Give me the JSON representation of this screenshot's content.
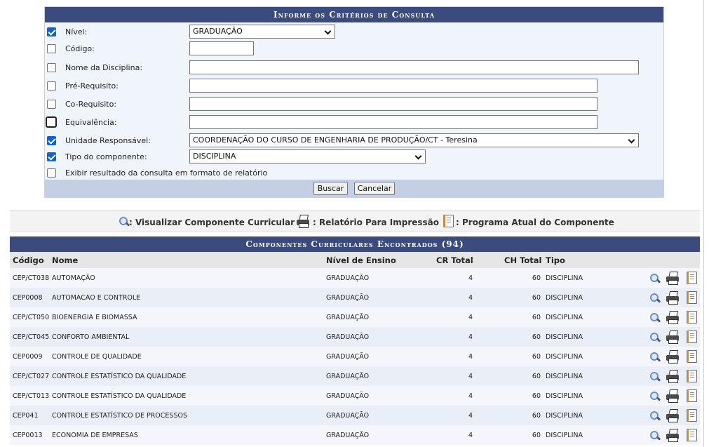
{
  "form": {
    "title": "Informe os Critérios de Consulta",
    "fields": [
      {
        "label": "Nível:",
        "checked": true,
        "control": "select",
        "value": "GRADUAÇÃO"
      },
      {
        "label": "Código:",
        "checked": false,
        "control": "input",
        "value": ""
      },
      {
        "label": "Nome da Disciplina:",
        "checked": false,
        "control": "input",
        "value": ""
      },
      {
        "label": "Pré-Requisito:",
        "checked": false,
        "control": "input",
        "value": ""
      },
      {
        "label": "Co-Requisito:",
        "checked": false,
        "control": "input",
        "value": ""
      },
      {
        "label": "Equivalência:",
        "checked": false,
        "control": "input",
        "value": ""
      },
      {
        "label": "Unidade Responsável:",
        "checked": true,
        "control": "select",
        "value": "COORDENAÇÃO DO CURSO DE ENGENHARIA DE PRODUÇÃO/CT - Teresina"
      },
      {
        "label": "Tipo do componente:",
        "checked": true,
        "control": "select",
        "value": "DISCIPLINA"
      },
      {
        "label": "Exibir resultado da consulta em formato de relatório",
        "checked": false,
        "control": "none",
        "value": ""
      }
    ],
    "search_button": "Buscar",
    "cancel_button": "Cancelar"
  },
  "legend": {
    "view": ": Visualizar Componente Curricular",
    "print": ": Relatório Para Impressão",
    "program": ": Programa Atual do Componente"
  },
  "results": {
    "title": "Componentes Curriculares Encontrados (94)",
    "headers": {
      "code": "Código",
      "name": "Nome",
      "level": "Nível de Ensino",
      "cr": "CR Total",
      "ch": "CH Total",
      "type": "Tipo"
    },
    "rows": [
      {
        "code": "CEP/CT038",
        "name": "AUTOMAÇÃO",
        "level": "GRADUAÇÃO",
        "cr": "4",
        "ch": "60",
        "type": "DISCIPLINA"
      },
      {
        "code": "CEP0008",
        "name": "AUTOMACAO E CONTROLE",
        "level": "GRADUAÇÃO",
        "cr": "4",
        "ch": "60",
        "type": "DISCIPLINA"
      },
      {
        "code": "CEP/CT050",
        "name": "BIOENERGIA E BIOMASSA",
        "level": "GRADUAÇÃO",
        "cr": "4",
        "ch": "60",
        "type": "DISCIPLINA"
      },
      {
        "code": "CEP/CT045",
        "name": "CONFORTO AMBIENTAL",
        "level": "GRADUAÇÃO",
        "cr": "4",
        "ch": "60",
        "type": "DISCIPLINA"
      },
      {
        "code": "CEP0009",
        "name": "CONTROLE DE QUALIDADE",
        "level": "GRADUAÇÃO",
        "cr": "4",
        "ch": "60",
        "type": "DISCIPLINA"
      },
      {
        "code": "CEP/CT027",
        "name": "CONTROLE ESTATÍSTICO DA QUALIDADE",
        "level": "GRADUAÇÃO",
        "cr": "4",
        "ch": "60",
        "type": "DISCIPLINA"
      },
      {
        "code": "CEP/CT013",
        "name": "CONTROLE ESTATÍSTICO DA QUALIDADE",
        "level": "GRADUAÇÃO",
        "cr": "4",
        "ch": "60",
        "type": "DISCIPLINA"
      },
      {
        "code": "CEP041",
        "name": "CONTROLE ESTATÍSTICO DE PROCESSOS",
        "level": "GRADUAÇÃO",
        "cr": "4",
        "ch": "60",
        "type": "DISCIPLINA"
      },
      {
        "code": "CEP0013",
        "name": "ECONOMIA DE EMPRESAS",
        "level": "GRADUAÇÃO",
        "cr": "4",
        "ch": "60",
        "type": "DISCIPLINA"
      }
    ]
  },
  "icons": {
    "view": "magnifier-icon",
    "print": "printer-icon",
    "program": "document-icon"
  },
  "colors": {
    "header_bg": "#3b4b7e",
    "form_bg": "#f0f4fb",
    "form_footer": "#c4cfe5",
    "checkbox": "#0a64d8"
  }
}
